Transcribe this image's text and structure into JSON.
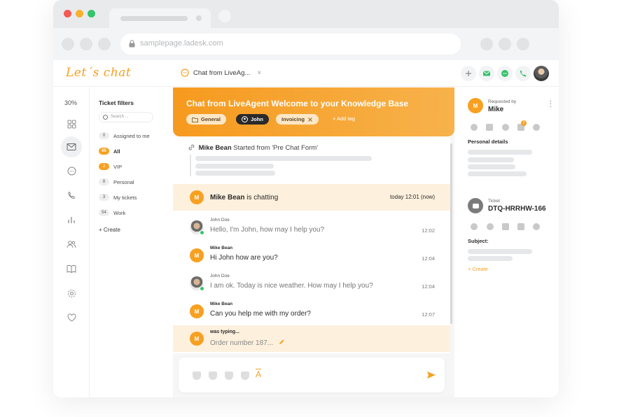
{
  "browser": {
    "url": "samplepage.ladesk.com"
  },
  "app": {
    "logo": "Let´s chat",
    "tab_label": "Chat from LiveAg...",
    "tab_close": "×"
  },
  "rail": {
    "percent": "30%",
    "icons": [
      "dashboard-icon",
      "inbox-icon",
      "chat-icon",
      "phone-icon",
      "reports-icon",
      "contacts-icon",
      "knowledge-base-icon",
      "settings-icon",
      "heart-icon"
    ]
  },
  "filters": {
    "title": "Ticket filters",
    "search_placeholder": "Search ...",
    "items": [
      {
        "badge": "0",
        "label": "Assigned to me"
      },
      {
        "badge": "65",
        "label": "All"
      },
      {
        "badge": "2",
        "label": "VIP"
      },
      {
        "badge": "8",
        "label": "Personal"
      },
      {
        "badge": "3",
        "label": "My tickets"
      },
      {
        "badge": "54",
        "label": "Work"
      }
    ],
    "create": "+ Create"
  },
  "chat": {
    "title": "Chat from LiveAgent Welcome to your Knowledge Base",
    "chips": [
      "General",
      "John",
      "Invoicing"
    ],
    "add_tag": "+ Add tag",
    "started_name": "Mike Bean",
    "started_text": "Started from 'Pre Chat Form'",
    "chatting_name": "Mike Bean",
    "chatting_text": "is chatting",
    "chatting_time": "today 12:01 (now)",
    "messages": [
      {
        "avatar": "photo",
        "name": "John Doe",
        "text": "Hello, I'm John, how may I help you?",
        "time": "12:02"
      },
      {
        "avatar": "M",
        "name": "Mike Bean",
        "text": "Hi John how are you?",
        "time": "12:04"
      },
      {
        "avatar": "photo",
        "name": "John Doe",
        "text": "I am ok. Today is nice weather. How may I help you?",
        "time": "12:04"
      },
      {
        "avatar": "M",
        "name": "Mike Bean",
        "text": "Can you help me with my order?",
        "time": "12:07"
      }
    ],
    "typing_label": "was typing...",
    "typing_text": "Order number 187...",
    "typing_avatar": "M"
  },
  "details": {
    "requested_by_label": "Requested by",
    "requester": "Mike",
    "avatar": "M",
    "personal_details": "Personal details",
    "ticket_label": "Ticket",
    "ticket_id": "DTQ-HRRHW-166",
    "subject_label": "Subject:",
    "create": "+ Create",
    "mail_badge": "2"
  },
  "colors": {
    "accent": "#f7a021",
    "accent_light": "#fdf0dd",
    "online": "#35c36b"
  }
}
